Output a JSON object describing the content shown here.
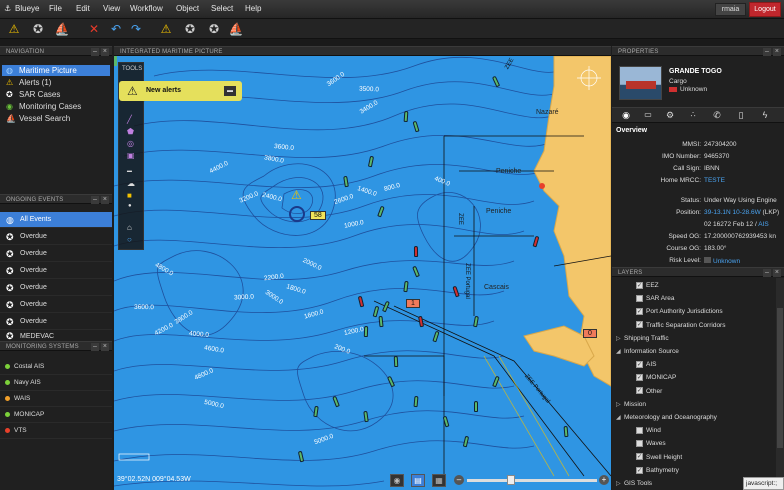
{
  "menubar": {
    "app_name": "Blueye",
    "menus": [
      "File",
      "Edit",
      "View",
      "Workflow",
      "Object",
      "Select",
      "Help"
    ],
    "username": "rmaia",
    "logout_label": "Logout"
  },
  "toolbar": {
    "icons": [
      "add-alert-icon",
      "add-case-icon",
      "add-vessel-icon",
      "delete-icon",
      "undo-icon",
      "redo-icon",
      "alert-tool-icon",
      "case-tool-icon",
      "case-tool-2-icon",
      "vessel-tool-icon"
    ]
  },
  "navigation": {
    "title": "NAVIGATION",
    "items": [
      {
        "label": "Maritime Picture",
        "icon": "globe-icon"
      },
      {
        "label": "Alerts (1)",
        "icon": "warning-icon"
      },
      {
        "label": "SAR Cases",
        "icon": "lifebuoy-icon"
      },
      {
        "label": "Monitoring Cases",
        "icon": "monitor-icon"
      },
      {
        "label": "Vessel Search",
        "icon": "vessel-icon"
      }
    ]
  },
  "ongoing_events": {
    "title": "ONGOING EVENTS",
    "items": [
      "All Events",
      "Overdue",
      "Overdue",
      "Overdue",
      "Overdue",
      "Overdue",
      "Overdue",
      "MEDEVAC"
    ]
  },
  "monitoring_systems": {
    "title": "MONITORING SYSTEMS",
    "items": [
      {
        "label": "Costal AIS",
        "color": "#7cd13a"
      },
      {
        "label": "Navy AIS",
        "color": "#7cd13a"
      },
      {
        "label": "WAIS",
        "color": "#f2a02a"
      },
      {
        "label": "MONICAP",
        "color": "#7cd13a"
      },
      {
        "label": "VTS",
        "color": "#e8402a"
      }
    ]
  },
  "map": {
    "title": "INTEGRATED MARITIME PICTURE",
    "tools_label": "TOOLS",
    "alert_text": "New alerts",
    "coordinates": "39°02.52N 009°04.53W",
    "place_labels": [
      "Nazaré",
      "Peniche",
      "Peniche",
      "Cascais"
    ],
    "track_labels": [
      "58",
      "1",
      "0"
    ],
    "zone_labels": [
      "ZEE",
      "ZEE",
      "ZEE Portugal",
      "ZEE Portugal"
    ],
    "depth_labels": [
      "3600.0",
      "3500.0",
      "3400.0",
      "3600.0",
      "4400.0",
      "3800.0",
      "3200.0",
      "2400.0",
      "2600.0",
      "1400.0",
      "800.0",
      "400.0",
      "1000.0",
      "2000.0",
      "2200.0",
      "4800.0",
      "3000.0",
      "3000.0",
      "3600.0",
      "3800.0",
      "4000.0",
      "4200.0",
      "4600.0",
      "4800.0",
      "5000.0",
      "5000.0",
      "1800.0",
      "1600.0",
      "200.0",
      "1200.0"
    ]
  },
  "properties": {
    "title": "PROPERTIES",
    "vessel_name": "GRANDE TOGO",
    "vessel_type": "Cargo",
    "flag": "Unknown",
    "tab_icons": [
      "eye-icon",
      "radar-icon",
      "gear-icon",
      "tracks-icon",
      "phone-icon",
      "document-icon",
      "lightning-icon"
    ],
    "overview_title": "Overview",
    "fields": [
      {
        "label": "MMSI:",
        "value": "247304200",
        "link": false
      },
      {
        "label": "IMO Number:",
        "value": "9465370",
        "link": false
      },
      {
        "label": "Call Sign:",
        "value": "IBNN",
        "link": false
      },
      {
        "label": "Home MRCC:",
        "value": "TESTE",
        "link": true
      }
    ],
    "status_fields": [
      {
        "label": "Status:",
        "value": "Under Way Using Engine"
      },
      {
        "label": "Position:",
        "value_link": "39-13.1N 10-28.6W",
        "value_suffix": " (LKP)"
      },
      {
        "label": "",
        "value": "02 16272 Feb 12 /",
        "value_link": "AIS"
      },
      {
        "label": "Speed OG:",
        "value": "17.200000762939453 kn"
      },
      {
        "label": "Course OG:",
        "value": "183.00°"
      },
      {
        "label": "Risk Level:",
        "value_link": "Unknown"
      }
    ]
  },
  "layers": {
    "title": "LAYERS",
    "rows": [
      {
        "label": "EEZ",
        "indent": 2,
        "check": true,
        "arrow": ""
      },
      {
        "label": "SAR Area",
        "indent": 2,
        "check": false,
        "arrow": ""
      },
      {
        "label": "Port Authority Jurisdictions",
        "indent": 2,
        "check": true,
        "arrow": ""
      },
      {
        "label": "Traffic Separation Corridors",
        "indent": 2,
        "check": true,
        "arrow": ""
      },
      {
        "label": "Shipping Traffic",
        "indent": 0,
        "check": null,
        "arrow": "▷"
      },
      {
        "label": "Information Source",
        "indent": 0,
        "check": null,
        "arrow": "◢"
      },
      {
        "label": "AIS",
        "indent": 2,
        "check": true,
        "arrow": ""
      },
      {
        "label": "MONICAP",
        "indent": 2,
        "check": true,
        "arrow": ""
      },
      {
        "label": "Other",
        "indent": 2,
        "check": true,
        "arrow": ""
      },
      {
        "label": "Mission",
        "indent": 0,
        "check": null,
        "arrow": "▷"
      },
      {
        "label": "Meteorology and Oceanography",
        "indent": 0,
        "check": null,
        "arrow": "◢"
      },
      {
        "label": "Wind",
        "indent": 2,
        "check": false,
        "arrow": ""
      },
      {
        "label": "Waves",
        "indent": 2,
        "check": false,
        "arrow": ""
      },
      {
        "label": "Swell Height",
        "indent": 2,
        "check": true,
        "arrow": ""
      },
      {
        "label": "Bathymetry",
        "indent": 2,
        "check": true,
        "arrow": ""
      },
      {
        "label": "GIS Tools",
        "indent": 0,
        "check": null,
        "arrow": "▷"
      }
    ]
  },
  "status_tip": "javascript:;",
  "colors": {
    "accent": "#3c7fd8",
    "sea": "#2f95e3",
    "land": "#f3c66a",
    "logout": "#c0272d",
    "alert": "#e5e05c"
  }
}
